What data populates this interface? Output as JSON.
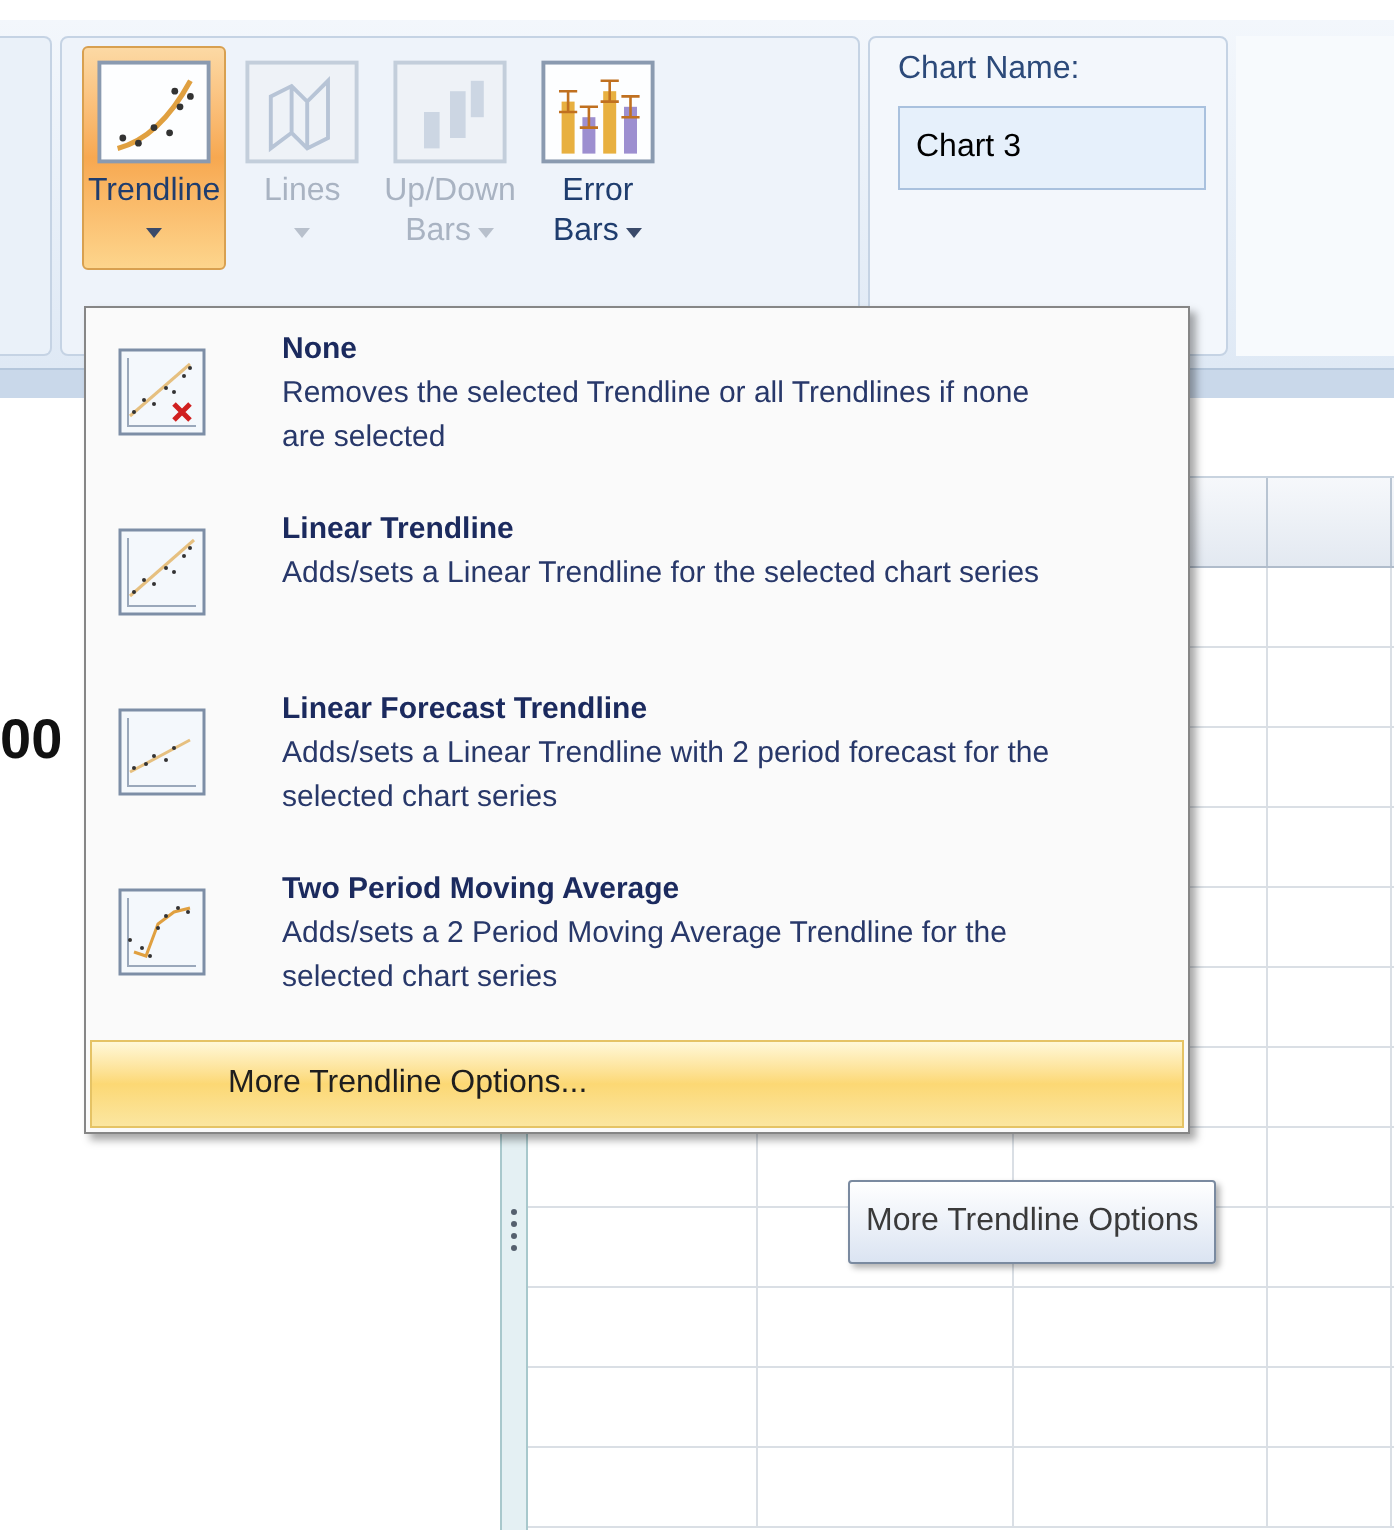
{
  "ribbon": {
    "buttons": [
      {
        "kind": "trendline",
        "lines": [
          "Trendline"
        ],
        "selected": true,
        "disabled": false
      },
      {
        "kind": "lines",
        "lines": [
          "Lines"
        ],
        "selected": false,
        "disabled": true
      },
      {
        "kind": "updown",
        "lines": [
          "Up/Down",
          "Bars"
        ],
        "selected": false,
        "disabled": true
      },
      {
        "kind": "errorbars",
        "lines": [
          "Error",
          "Bars"
        ],
        "selected": false,
        "disabled": false
      }
    ],
    "chart_name": {
      "label": "Chart Name:",
      "value": "Chart 3"
    }
  },
  "sheet": {
    "cell_fragment": "00"
  },
  "menu": {
    "items": [
      {
        "kind": "none",
        "title": "None",
        "description": "Removes the selected Trendline or all Trendlines if none are selected"
      },
      {
        "kind": "linear",
        "title": "Linear Trendline",
        "description": "Adds/sets a Linear Trendline for the selected chart series"
      },
      {
        "kind": "forecast",
        "title": "Linear Forecast Trendline",
        "description": "Adds/sets a Linear Trendline with 2 period forecast for the selected chart series"
      },
      {
        "kind": "moving_average",
        "title": "Two Period Moving Average",
        "description": "Adds/sets a 2 Period Moving Average Trendline for the selected chart series"
      }
    ],
    "footer": {
      "label": "More Trendline Options...",
      "selected": true
    }
  },
  "tooltip": {
    "text": "More Trendline Options"
  }
}
